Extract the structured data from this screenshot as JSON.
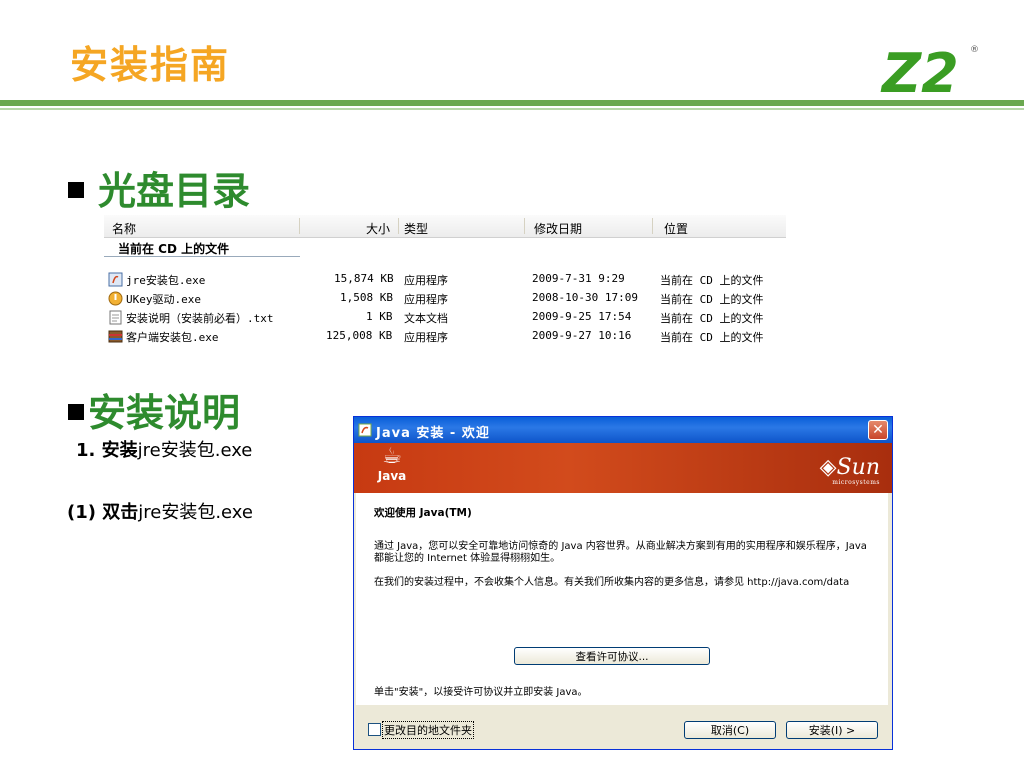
{
  "slide": {
    "title": "安装指南",
    "logo_text": "Z2",
    "logo_registered": "®",
    "brand_colors": {
      "title": "#f5a623",
      "heading": "#2e8b2e",
      "rule": "#6aa84f",
      "logo": "#3a9d23"
    }
  },
  "section_cd": {
    "heading": "光盘目录"
  },
  "explorer": {
    "columns": [
      "名称",
      "大小",
      "类型",
      "修改日期",
      "位置"
    ],
    "group": "当前在 CD 上的文件",
    "rows": [
      {
        "icon": "java-installer-icon",
        "name": "jre安装包.exe",
        "size": "15,874 KB",
        "type": "应用程序",
        "modified": "2009-7-31 9:29",
        "location": "当前在 CD 上的文件"
      },
      {
        "icon": "ukey-driver-icon",
        "name": "UKey驱动.exe",
        "size": "1,508 KB",
        "type": "应用程序",
        "modified": "2008-10-30 17:09",
        "location": "当前在 CD 上的文件"
      },
      {
        "icon": "text-document-icon",
        "name": "安装说明（安装前必看）.txt",
        "size": "1 KB",
        "type": "文本文档",
        "modified": "2009-9-25 17:54",
        "location": "当前在 CD 上的文件"
      },
      {
        "icon": "archive-installer-icon",
        "name": "客户端安装包.exe",
        "size": "125,008 KB",
        "type": "应用程序",
        "modified": "2009-9-27 10:16",
        "location": "当前在 CD 上的文件"
      }
    ]
  },
  "section_install": {
    "heading": "安装说明",
    "step1_num": "1. ",
    "step1_bold": "安装",
    "step1_rest": "jre安装包.exe",
    "step2_num": "(1) ",
    "step2_bold": "双击",
    "step2_rest": "jre安装包.exe"
  },
  "dialog": {
    "title": "Java 安装 - 欢迎",
    "close": "✕",
    "java_word": "Java",
    "sun_word": "Sun",
    "sun_sub": "microsystems",
    "welcome": "欢迎使用 Java(TM)",
    "para1": "通过 Java，您可以安全可靠地访问惊奇的 Java 内容世界。从商业解决方案到有用的实用程序和娱乐程序，Java 都能让您的 Internet 体验显得栩栩如生。",
    "para2": "在我们的安装过程中，不会收集个人信息。有关我们所收集内容的更多信息，请参见 http://java.com/data",
    "license_button": "查看许可协议...",
    "click_note": "单击\"安装\"，以接受许可协议并立即安装 Java。",
    "change_folder": "更改目的地文件夹",
    "cancel_button": "取消(C)",
    "install_button": "安装(I) >"
  }
}
